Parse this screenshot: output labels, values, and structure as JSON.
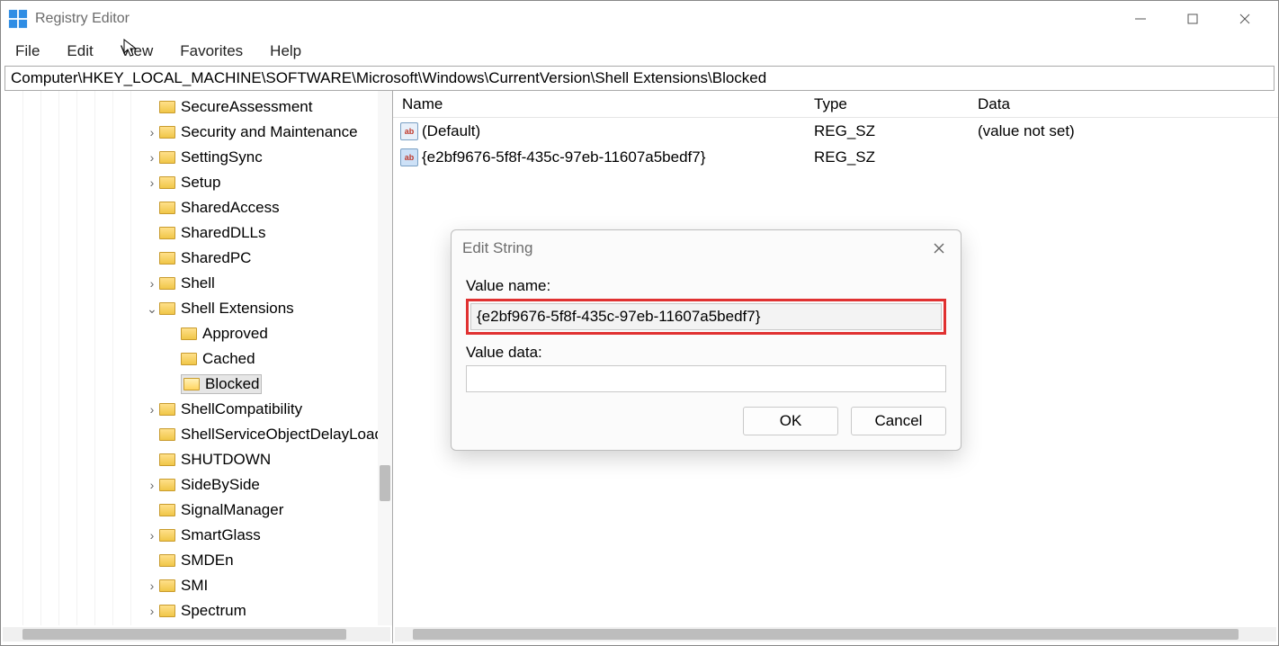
{
  "window": {
    "title": "Registry Editor"
  },
  "menu": {
    "file": "File",
    "edit": "Edit",
    "view": "View",
    "favorites": "Favorites",
    "help": "Help"
  },
  "address": "Computer\\HKEY_LOCAL_MACHINE\\SOFTWARE\\Microsoft\\Windows\\CurrentVersion\\Shell Extensions\\Blocked",
  "tree": {
    "items": [
      {
        "indent": 176,
        "chev": "",
        "label": "SecureAssessment"
      },
      {
        "indent": 176,
        "chev": "›",
        "label": "Security and Maintenance"
      },
      {
        "indent": 176,
        "chev": "›",
        "label": "SettingSync"
      },
      {
        "indent": 176,
        "chev": "›",
        "label": "Setup"
      },
      {
        "indent": 176,
        "chev": "",
        "label": "SharedAccess"
      },
      {
        "indent": 176,
        "chev": "",
        "label": "SharedDLLs"
      },
      {
        "indent": 176,
        "chev": "",
        "label": "SharedPC"
      },
      {
        "indent": 176,
        "chev": "›",
        "label": "Shell"
      },
      {
        "indent": 176,
        "chev": "⌄",
        "label": "Shell Extensions"
      },
      {
        "indent": 200,
        "chev": "",
        "label": "Approved"
      },
      {
        "indent": 200,
        "chev": "",
        "label": "Cached"
      },
      {
        "indent": 200,
        "chev": "",
        "label": "Blocked",
        "selected": true,
        "open": true
      },
      {
        "indent": 176,
        "chev": "›",
        "label": "ShellCompatibility"
      },
      {
        "indent": 176,
        "chev": "",
        "label": "ShellServiceObjectDelayLoad"
      },
      {
        "indent": 176,
        "chev": "",
        "label": "SHUTDOWN"
      },
      {
        "indent": 176,
        "chev": "›",
        "label": "SideBySide"
      },
      {
        "indent": 176,
        "chev": "",
        "label": "SignalManager"
      },
      {
        "indent": 176,
        "chev": "›",
        "label": "SmartGlass"
      },
      {
        "indent": 176,
        "chev": "",
        "label": "SMDEn"
      },
      {
        "indent": 176,
        "chev": "›",
        "label": "SMI"
      },
      {
        "indent": 176,
        "chev": "›",
        "label": "Spectrum"
      }
    ]
  },
  "list": {
    "columns": {
      "name": "Name",
      "type": "Type",
      "data": "Data"
    },
    "rows": [
      {
        "name": "(Default)",
        "type": "REG_SZ",
        "data": "(value not set)",
        "selected": false
      },
      {
        "name": "{e2bf9676-5f8f-435c-97eb-11607a5bedf7}",
        "type": "REG_SZ",
        "data": "",
        "selected": true
      }
    ]
  },
  "dialog": {
    "title": "Edit String",
    "value_name_label": "Value name:",
    "value_name": "{e2bf9676-5f8f-435c-97eb-11607a5bedf7}",
    "value_data_label": "Value data:",
    "value_data": "",
    "ok": "OK",
    "cancel": "Cancel"
  }
}
